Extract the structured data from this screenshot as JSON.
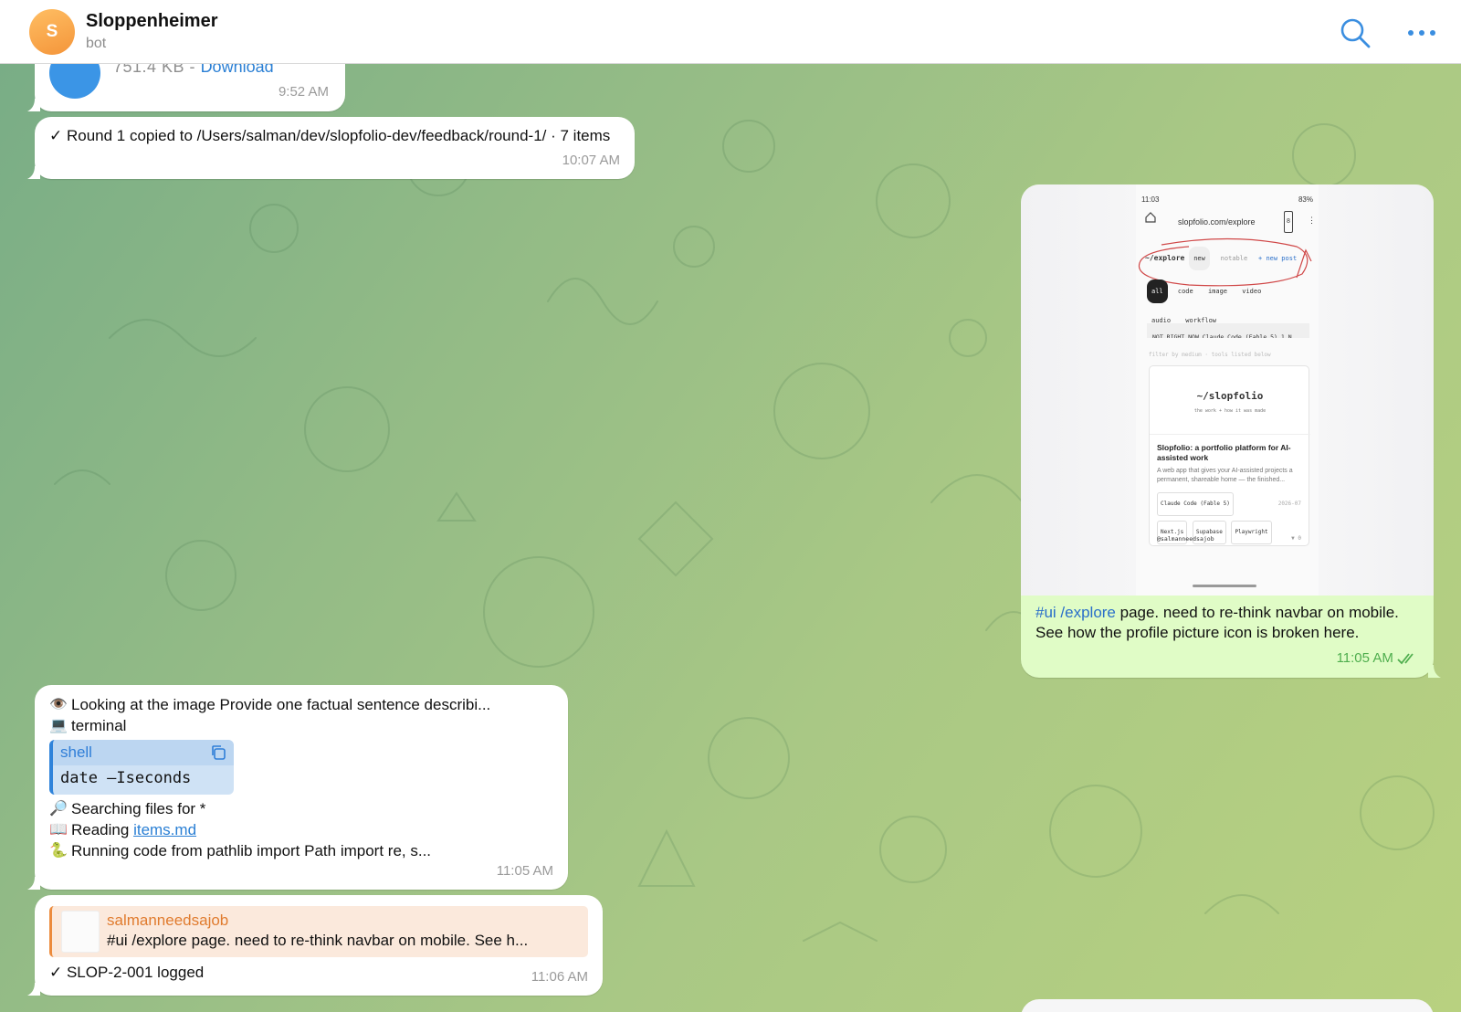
{
  "header": {
    "avatar_letter": "S",
    "chat_name": "Sloppenheimer",
    "chat_status": "bot"
  },
  "messages": {
    "file": {
      "size": "751.4 KB - ",
      "download_label": "Download",
      "time": "9:52 AM"
    },
    "round": {
      "text": "✓ Round 1 copied to /Users/salman/dev/slopfolio-dev/feedback/round-1/ · 7 items",
      "time": "10:07 AM"
    },
    "image_post": {
      "tags": "#ui /explore",
      "caption": " page. need to re-think navbar on mobile. See how the profile picture icon is broken here.",
      "time": "11:05 AM",
      "screenshot": {
        "status_time": "11:03",
        "status_right": "83%",
        "url": "slopfolio.com/explore",
        "tab_count": "8",
        "nav_path": "~/explore",
        "nav_new": "new",
        "nav_notable": "notable",
        "nav_newpost": "+ new post",
        "filters": [
          "all",
          "code",
          "image",
          "video",
          "audio",
          "workflow"
        ],
        "not_right_now": "NOT RIGHT NOW  Claude Code (Fable 5)  1  N",
        "hint": "filter by medium · tools listed below",
        "card_logo": "~/slopfolio",
        "card_logo_sub": "the work + how it was made",
        "card_title": "Slopfolio: a portfolio platform for AI-assisted work",
        "card_desc": "A web app that gives your AI-assisted projects a permanent, shareable home — the finished...",
        "card_tags": [
          "Claude Code (Fable 5)",
          "Next.js",
          "Supabase",
          "Playwright"
        ],
        "card_date": "2026-07",
        "card_user": "@salmanneedsajob",
        "card_votes": "▼ 0"
      }
    },
    "tool": {
      "lines": {
        "looking": "Looking at the image Provide one factual sentence describi...",
        "terminal": "terminal",
        "searching": "Searching files for *",
        "reading_prefix": "Reading ",
        "reading_link": "items.md",
        "running": "Running code from pathlib import Path import re, s..."
      },
      "code": {
        "lang": "shell",
        "command": "date –Iseconds"
      },
      "time": "11:05 AM"
    },
    "reply": {
      "quote_author": "salmanneedsajob",
      "quote_text": "#ui /explore page. need to re-think navbar on mobile. See h...",
      "text": "✓ SLOP-2-001 logged",
      "time": "11:06 AM"
    }
  },
  "colors": {
    "accent_blue": "#2a7fd4",
    "outgoing_bubble": "#e0fcc6",
    "quote_orange": "#e07b2e"
  }
}
